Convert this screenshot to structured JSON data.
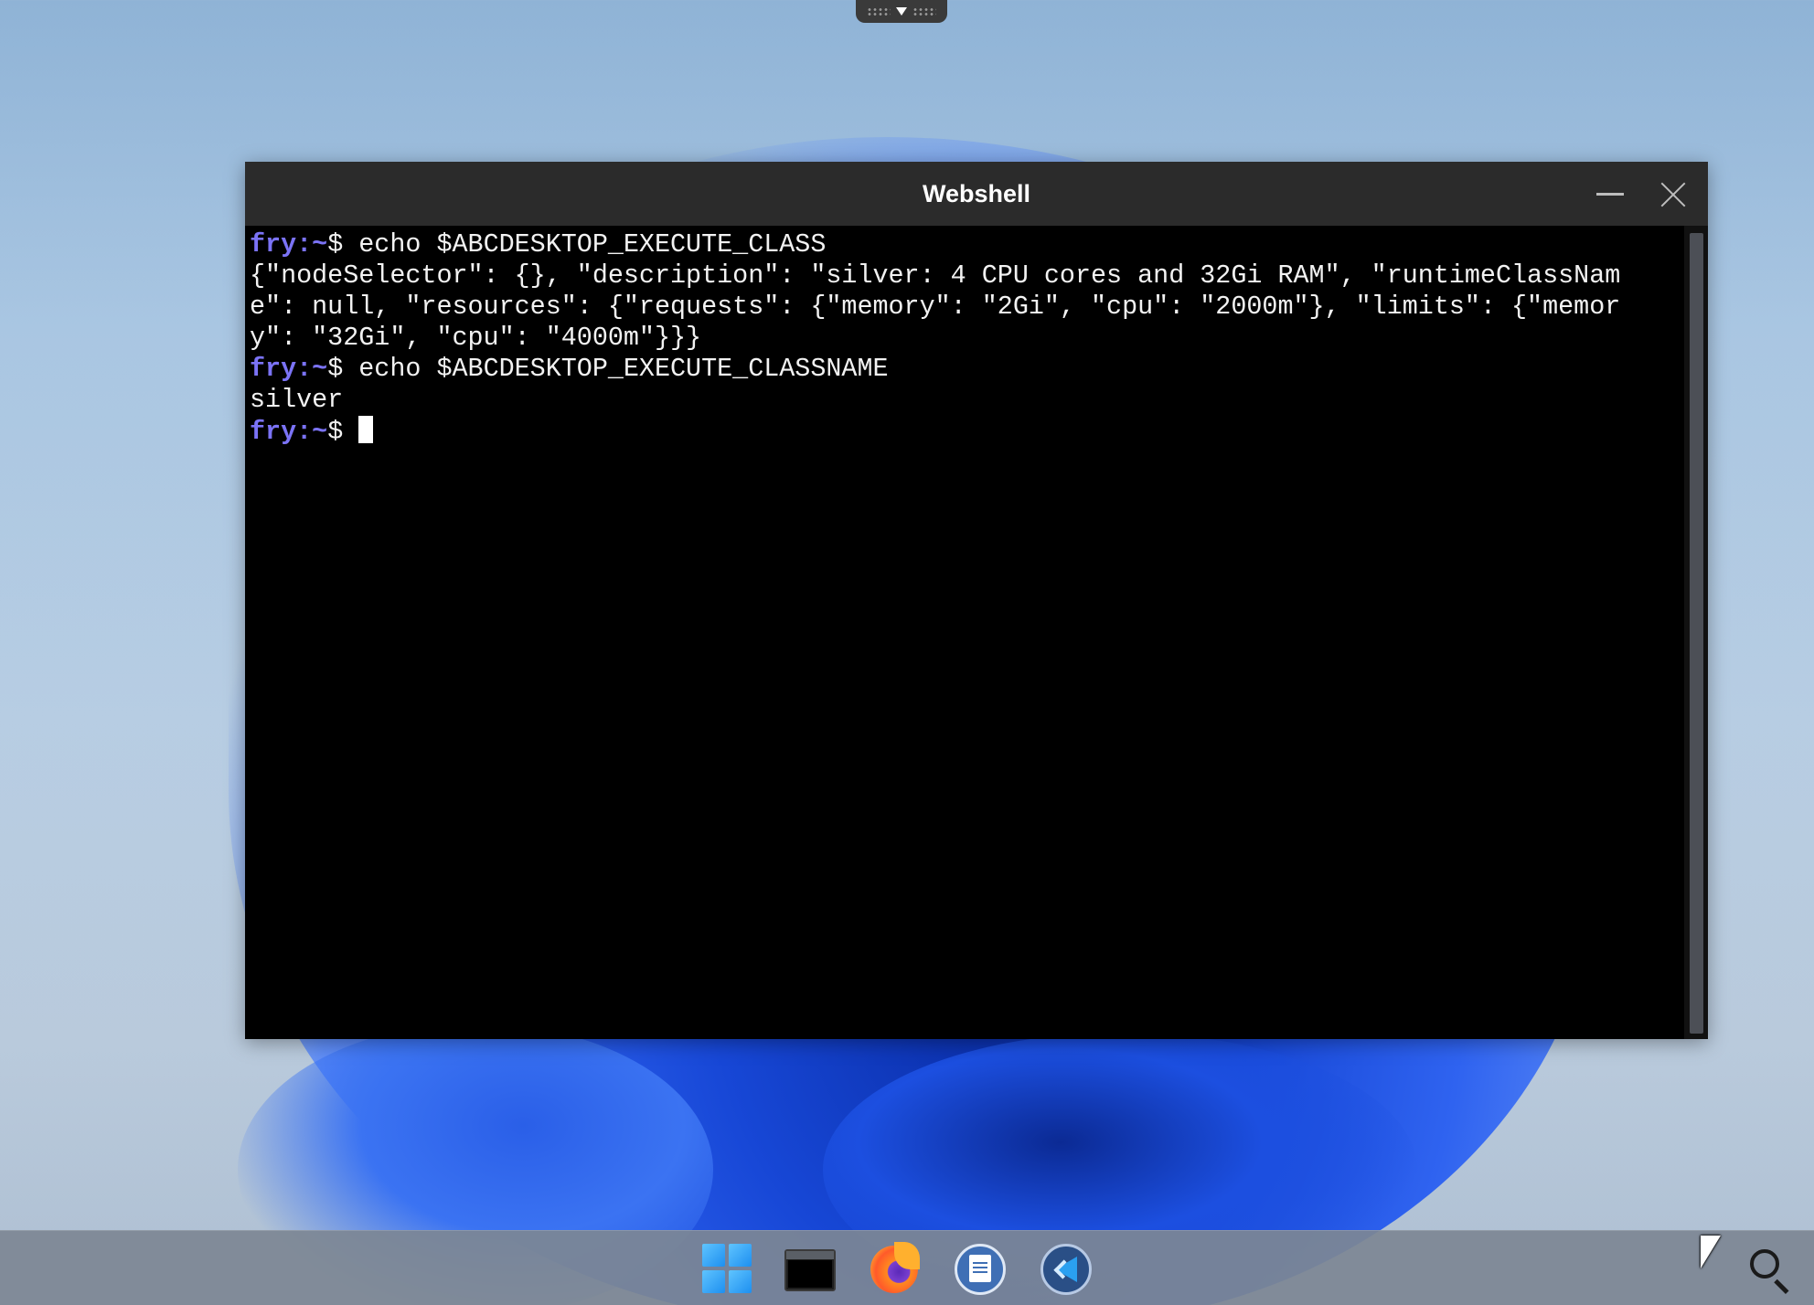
{
  "window": {
    "title": "Webshell"
  },
  "terminal": {
    "prompt": "fry:~",
    "lines": [
      {
        "type": "command",
        "prompt": "fry:~",
        "symbol": "$ ",
        "text": "echo $ABCDESKTOP_EXECUTE_CLASS"
      },
      {
        "type": "output",
        "text": "{\"nodeSelector\": {}, \"description\": \"silver: 4 CPU cores and 32Gi RAM\", \"runtimeClassNam"
      },
      {
        "type": "output",
        "text": "e\": null, \"resources\": {\"requests\": {\"memory\": \"2Gi\", \"cpu\": \"2000m\"}, \"limits\": {\"memor"
      },
      {
        "type": "output",
        "text": "y\": \"32Gi\", \"cpu\": \"4000m\"}}}"
      },
      {
        "type": "command",
        "prompt": "fry:~",
        "symbol": "$ ",
        "text": "echo $ABCDESKTOP_EXECUTE_CLASSNAME"
      },
      {
        "type": "output",
        "text": "silver"
      },
      {
        "type": "command",
        "prompt": "fry:~",
        "symbol": "$ ",
        "text": ""
      }
    ],
    "colors": {
      "prompt": "#7b73f6",
      "text": "#f2f2f2",
      "background": "#000000"
    }
  },
  "taskbar": {
    "items": [
      {
        "name": "start-menu",
        "icon": "windows-start-icon"
      },
      {
        "name": "terminal",
        "icon": "terminal-icon"
      },
      {
        "name": "firefox",
        "icon": "firefox-icon"
      },
      {
        "name": "writer",
        "icon": "document-writer-icon"
      },
      {
        "name": "vscode",
        "icon": "vscode-icon"
      },
      {
        "name": "search",
        "icon": "search-icon"
      }
    ]
  }
}
